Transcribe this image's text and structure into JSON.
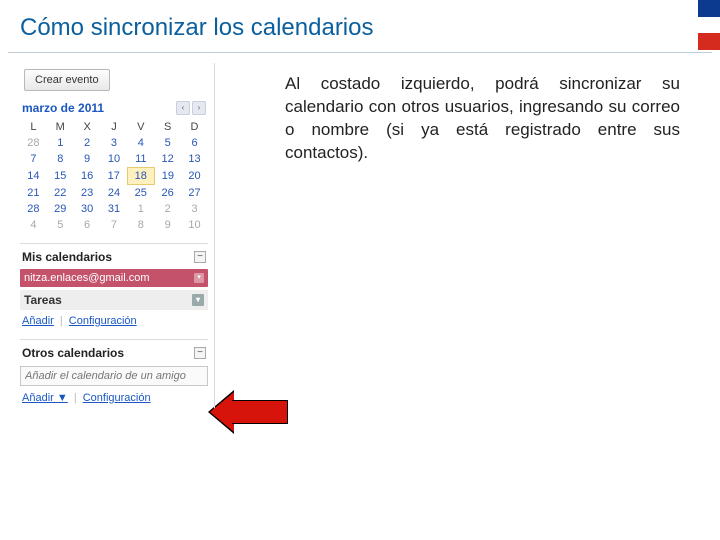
{
  "title": "Cómo sincronizar los calendarios",
  "createEvent": "Crear evento",
  "monthLabel": "marzo de 2011",
  "weekdays": [
    "L",
    "M",
    "X",
    "J",
    "V",
    "S",
    "D"
  ],
  "calRows": [
    [
      {
        "v": "28",
        "dim": true
      },
      {
        "v": "1"
      },
      {
        "v": "2"
      },
      {
        "v": "3"
      },
      {
        "v": "4"
      },
      {
        "v": "5"
      },
      {
        "v": "6"
      }
    ],
    [
      {
        "v": "7"
      },
      {
        "v": "8"
      },
      {
        "v": "9"
      },
      {
        "v": "10"
      },
      {
        "v": "11"
      },
      {
        "v": "12"
      },
      {
        "v": "13"
      }
    ],
    [
      {
        "v": "14"
      },
      {
        "v": "15"
      },
      {
        "v": "16"
      },
      {
        "v": "17"
      },
      {
        "v": "18",
        "today": true
      },
      {
        "v": "19"
      },
      {
        "v": "20"
      }
    ],
    [
      {
        "v": "21"
      },
      {
        "v": "22"
      },
      {
        "v": "23"
      },
      {
        "v": "24"
      },
      {
        "v": "25"
      },
      {
        "v": "26"
      },
      {
        "v": "27"
      }
    ],
    [
      {
        "v": "28"
      },
      {
        "v": "29"
      },
      {
        "v": "30"
      },
      {
        "v": "31"
      },
      {
        "v": "1",
        "dim": true
      },
      {
        "v": "2",
        "dim": true
      },
      {
        "v": "3",
        "dim": true
      }
    ],
    [
      {
        "v": "4",
        "dim": true
      },
      {
        "v": "5",
        "dim": true
      },
      {
        "v": "6",
        "dim": true
      },
      {
        "v": "7",
        "dim": true
      },
      {
        "v": "8",
        "dim": true
      },
      {
        "v": "9",
        "dim": true
      },
      {
        "v": "10",
        "dim": true
      }
    ]
  ],
  "myCals": {
    "header": "Mis calendarios",
    "item": "nitza.enlaces@gmail.com",
    "tasks": "Tareas",
    "add": "Añadir",
    "config": "Configuración"
  },
  "otherCals": {
    "header": "Otros calendarios",
    "placeholder": "Añadir el calendario de un amigo",
    "add": "Añadir ▼",
    "config": "Configuración"
  },
  "paragraph": "Al costado izquierdo, podrá sincronizar su calendario con otros usuarios, ingresando su correo o nombre (si ya está registrado entre sus contactos).",
  "icons": {
    "prev": "‹",
    "next": "›",
    "minus": "−",
    "dd": "▾"
  }
}
